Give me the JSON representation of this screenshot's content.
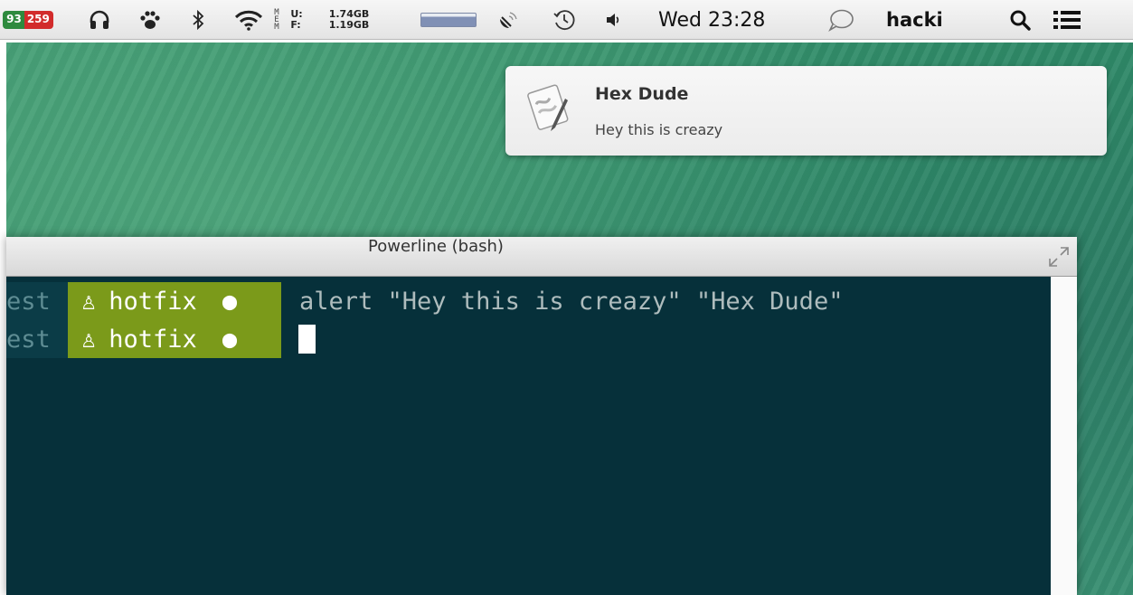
{
  "menubar": {
    "badge_left": "93",
    "badge_right": "259",
    "memory": {
      "label_stack": [
        "M",
        "E",
        "M"
      ],
      "used_label": "U:",
      "free_label": "F:",
      "used_value": "1.74GB",
      "free_value": "1.19GB",
      "fill_fraction": 0.75
    },
    "clock": "Wed 23:28",
    "user": "hacki",
    "icons": [
      "headphones-icon",
      "paw-icon",
      "bluetooth-icon",
      "wifi-icon",
      "satellite-icon",
      "time-machine-icon",
      "volume-icon",
      "chat-bubble-icon",
      "search-icon",
      "list-icon"
    ]
  },
  "notification": {
    "title": "Hex Dude",
    "body": "Hey this is creazy",
    "icon": "script-editor-icon"
  },
  "terminal": {
    "title": "Powerline (bash)",
    "lines": [
      {
        "user": "est",
        "branch": "hotfix",
        "command": "alert \"Hey this is creazy\" \"Hex Dude\""
      },
      {
        "user": "est",
        "branch": "hotfix",
        "command": ""
      }
    ],
    "colors": {
      "background": "#06303a",
      "branch_segment": "#7b9a1a",
      "text": "#aebcbd"
    }
  }
}
